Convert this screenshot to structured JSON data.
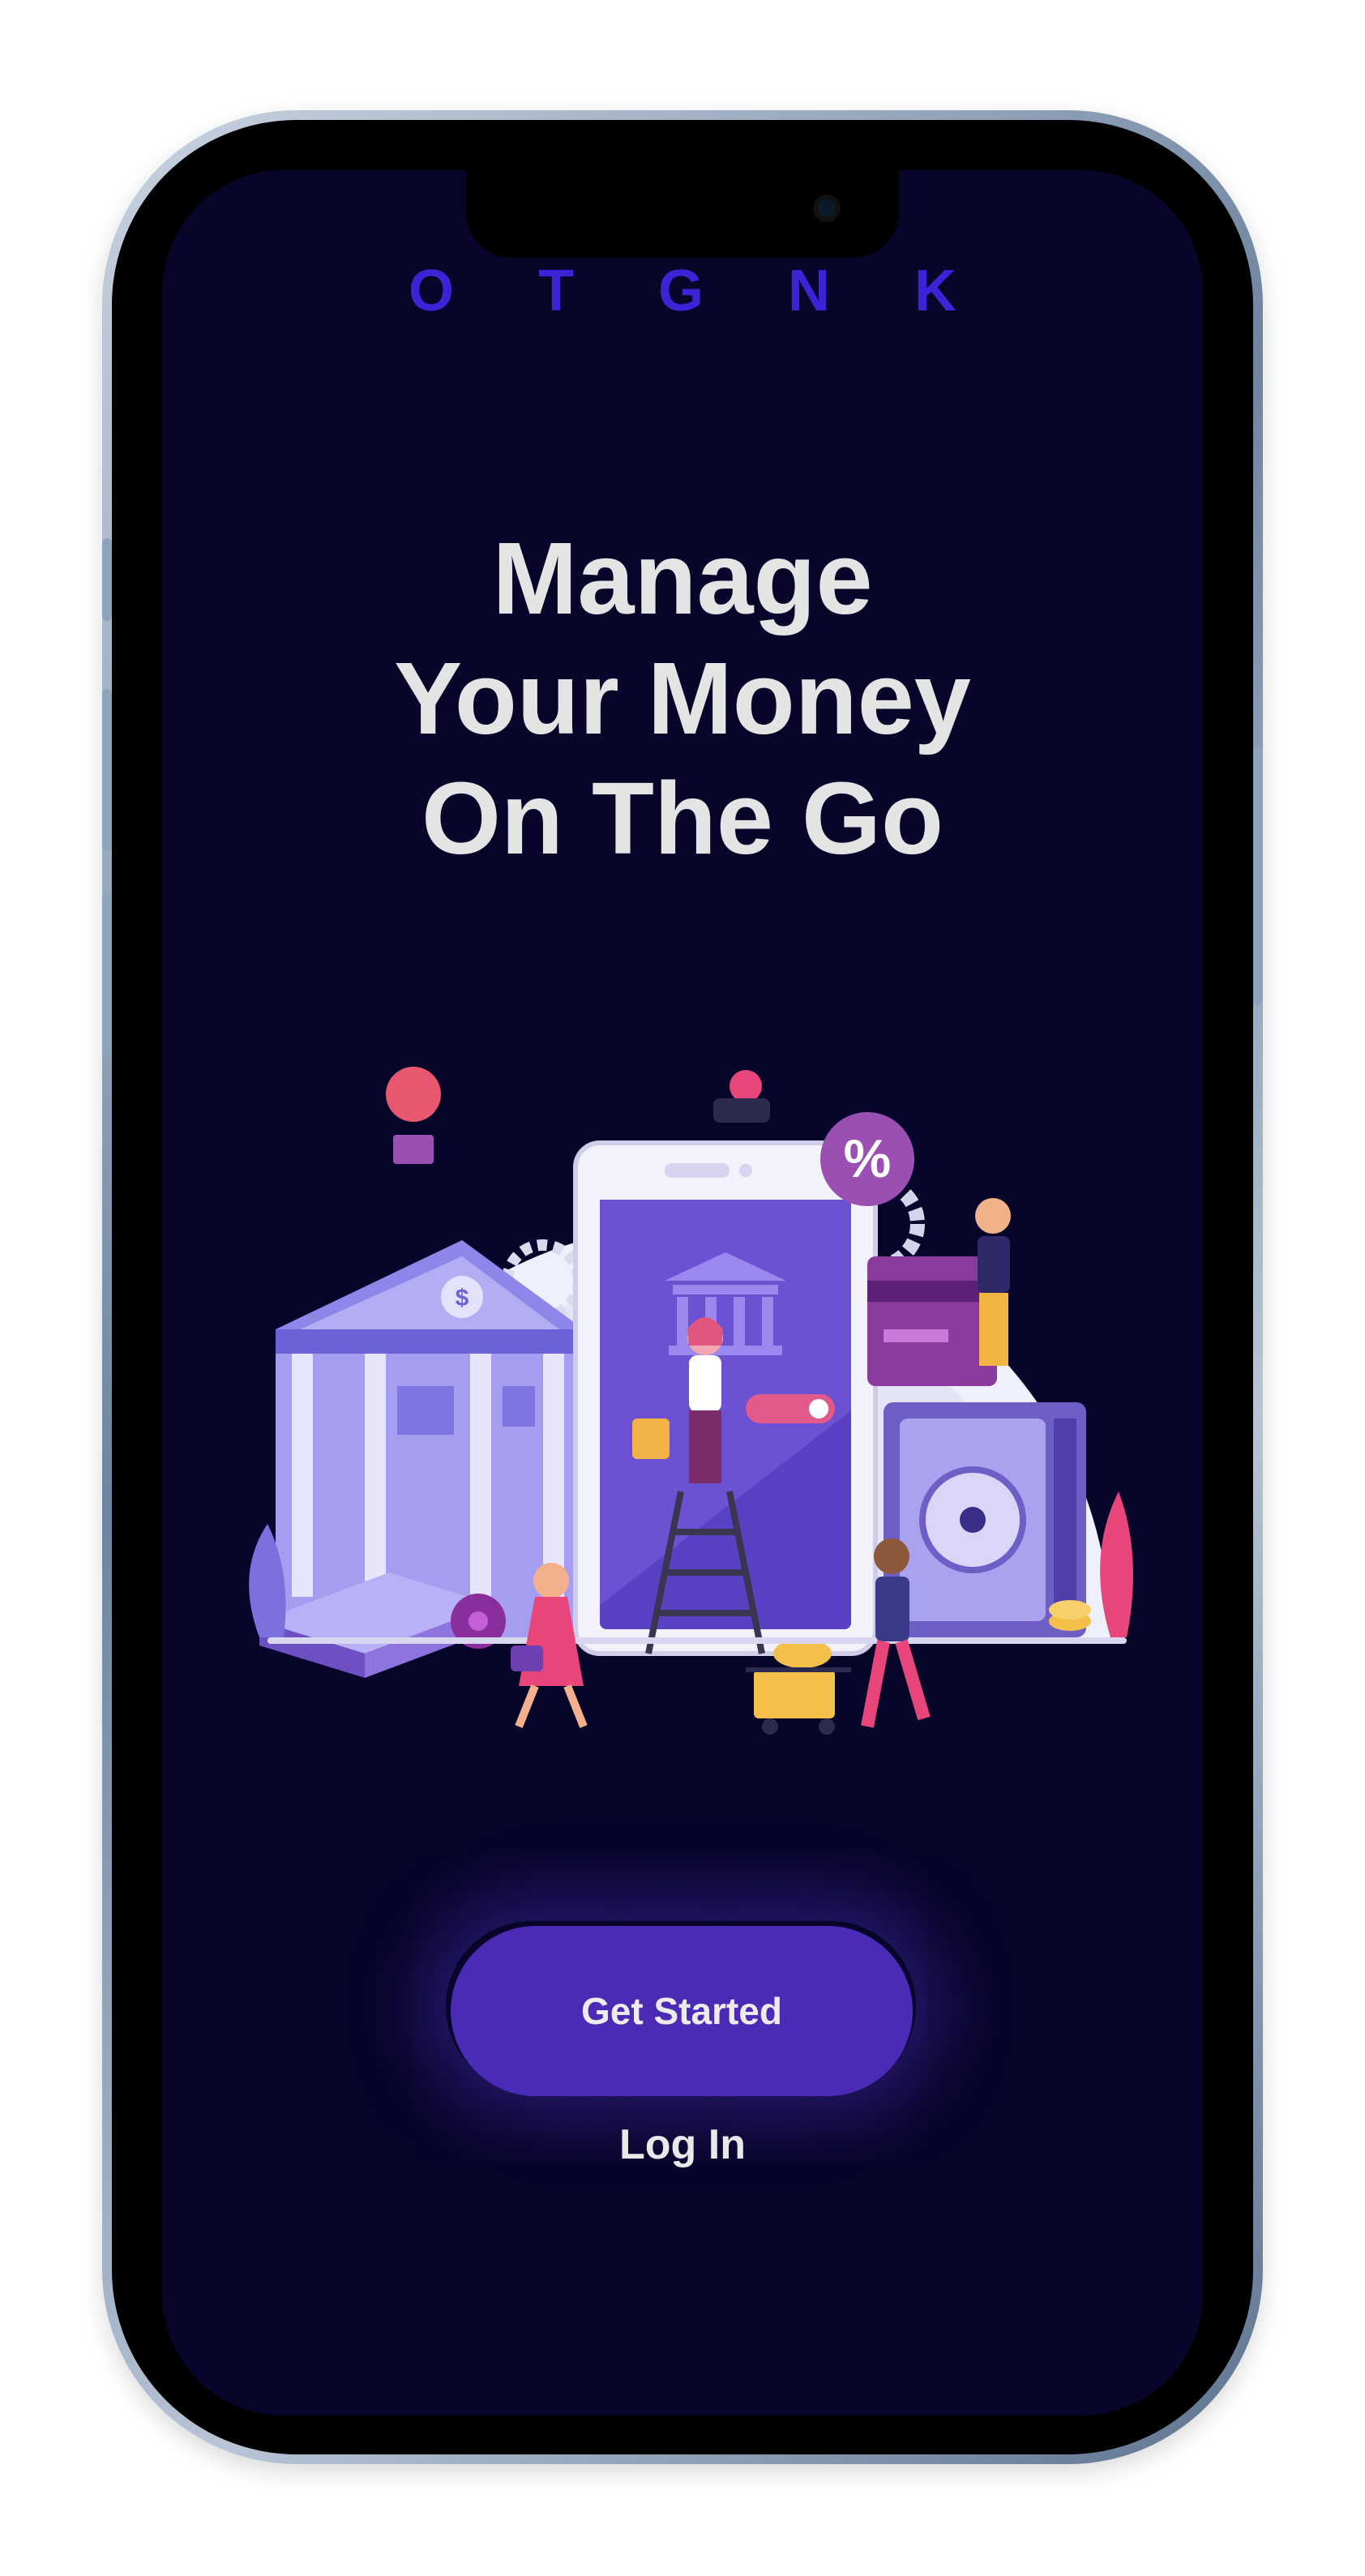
{
  "brand": {
    "name": "O T G N K"
  },
  "hero": {
    "line1": "Manage",
    "line2": "Your Money",
    "line3": "On The Go"
  },
  "actions": {
    "primary_label": "Get Started",
    "secondary_label": "Log In"
  },
  "illustration": {
    "bank_sign": "$",
    "badge": "%"
  },
  "colors": {
    "background": "#07052a",
    "accent": "#4b2bb5",
    "brand_text": "#3b24d6",
    "headline": "#e4e4e4"
  }
}
